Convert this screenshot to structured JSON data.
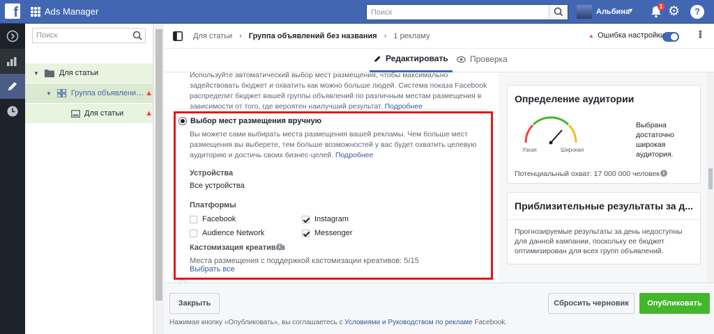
{
  "topbar": {
    "app_name": "Ads Manager",
    "search_placeholder": "Поиск",
    "user_name": "Альбина",
    "notifications_count": "1"
  },
  "tree": {
    "search_placeholder": "Поиск",
    "items": [
      {
        "label": "Для статьи",
        "level": "campaign"
      },
      {
        "label": "Группа объявлений ...",
        "level": "adset"
      },
      {
        "label": "Для статьи",
        "level": "ad"
      }
    ]
  },
  "editor": {
    "breadcrumb": [
      "Для статьи",
      "Группа объявлений без названия",
      "1 рекламу"
    ],
    "error_label": "Ошибка настройки",
    "toggle_on": true,
    "tabs": [
      {
        "label": "Редактировать",
        "active": true
      },
      {
        "label": "Проверка",
        "active": false
      }
    ]
  },
  "placement": {
    "auto_text": "Используйте автоматический выбор мест размещения, чтобы максимально задействовать бюджет и охватить как можно больше людей. Система показа Facebook распределит бюджет вашей группы объявлений по различным местам размещения в зависимости от того, где вероятен наилучший результат.",
    "more_link": "Подробнее",
    "manual_title": "Выбор мест размещения вручную",
    "manual_text": "Вы можете сами выбирать места размещения вашей рекламы. Чем больше мест размещения вы выберете, тем больше возможностей у вас будет охватить целевую аудиторию и достичь своих бизнес-целей.",
    "devices_label": "Устройства",
    "devices_value": "Все устройства",
    "platforms_label": "Платформы",
    "platforms": [
      {
        "name": "Facebook",
        "checked": false
      },
      {
        "name": "Audience Network",
        "checked": false
      },
      {
        "name": "Instagram",
        "checked": true
      },
      {
        "name": "Messenger",
        "checked": true
      }
    ],
    "customization_label": "Кастомизация креативов",
    "customization_text": "Места размещения с поддержкой кастомизации креативов: 5/15",
    "select_all": "Выбрать все"
  },
  "audience": {
    "title": "Определение аудитории",
    "narrow": "Узкая",
    "broad": "Широкая",
    "description": "Выбрана достаточно широкая аудитория.",
    "reach": "Потенциальный охват: 17 000 000 человек"
  },
  "estimates": {
    "title": "Приблизительные результаты за д...",
    "text": "Прогнозируемые результаты за день недоступны для данной кампании, поскольку ее бюджет оптимизирован для всех групп объявлений."
  },
  "footer": {
    "close": "Закрыть",
    "reset": "Сбросить черновик",
    "publish": "Опубликовать",
    "legal_prefix": "Нажимая кнопку «Опубликовать», вы соглашаетесь с",
    "legal_link": "Условиями и Руководством по рекламе",
    "legal_suffix": "Facebook."
  },
  "colors": {
    "brand": "#4267b2",
    "publish": "#42b72a",
    "highlight": "#e4171b",
    "error": "#fa3e3e"
  }
}
